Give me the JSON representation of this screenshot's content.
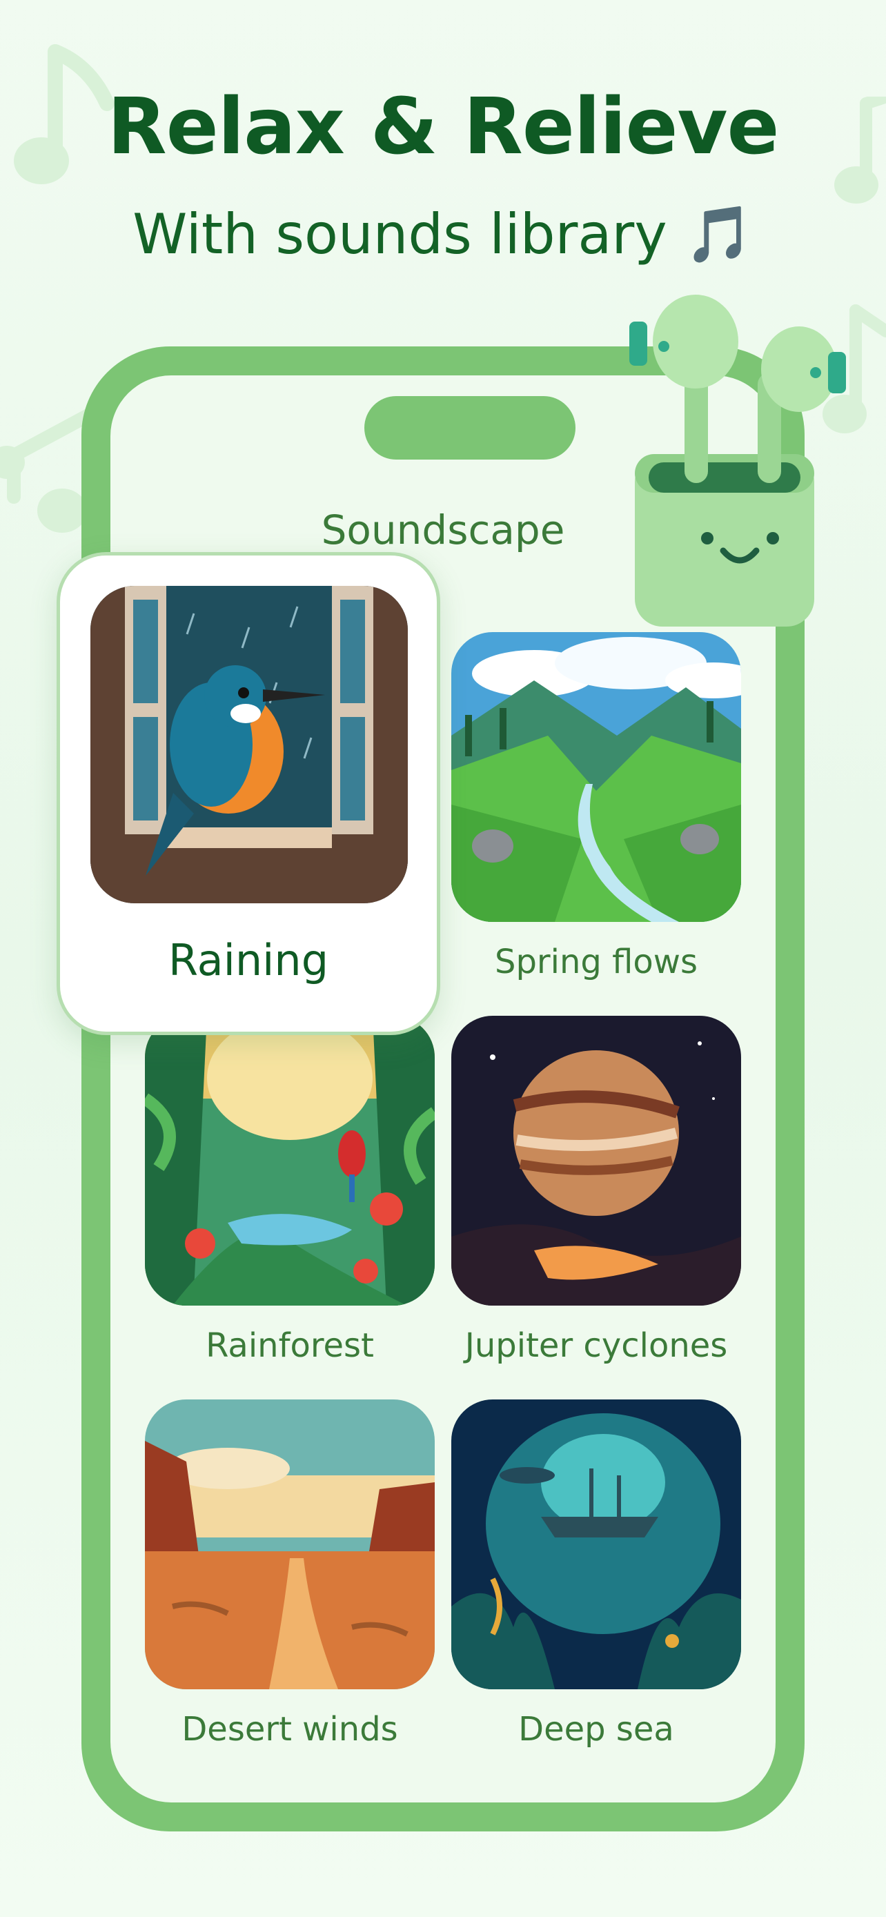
{
  "hero": {
    "title": "Relax & Relieve",
    "subtitle": "With sounds library 🎵"
  },
  "screen": {
    "title": "Soundscape"
  },
  "sounds": [
    {
      "label": "Raining",
      "selected": true,
      "thumbnail": "kingfisher-in-rainy-window"
    },
    {
      "label": "Spring flows",
      "selected": false,
      "thumbnail": "green-valley-stream"
    },
    {
      "label": "Rainforest",
      "selected": false,
      "thumbnail": "jungle-with-parrot"
    },
    {
      "label": "Jupiter cyclones",
      "selected": false,
      "thumbnail": "jupiter-planet"
    },
    {
      "label": "Desert winds",
      "selected": false,
      "thumbnail": "desert-road"
    },
    {
      "label": "Deep sea",
      "selected": false,
      "thumbnail": "underwater-shipwreck"
    }
  ],
  "colors": {
    "accent": "#7cc574",
    "heading": "#0f5a24",
    "label": "#3b7a39",
    "screen_bg": "#effaee"
  }
}
